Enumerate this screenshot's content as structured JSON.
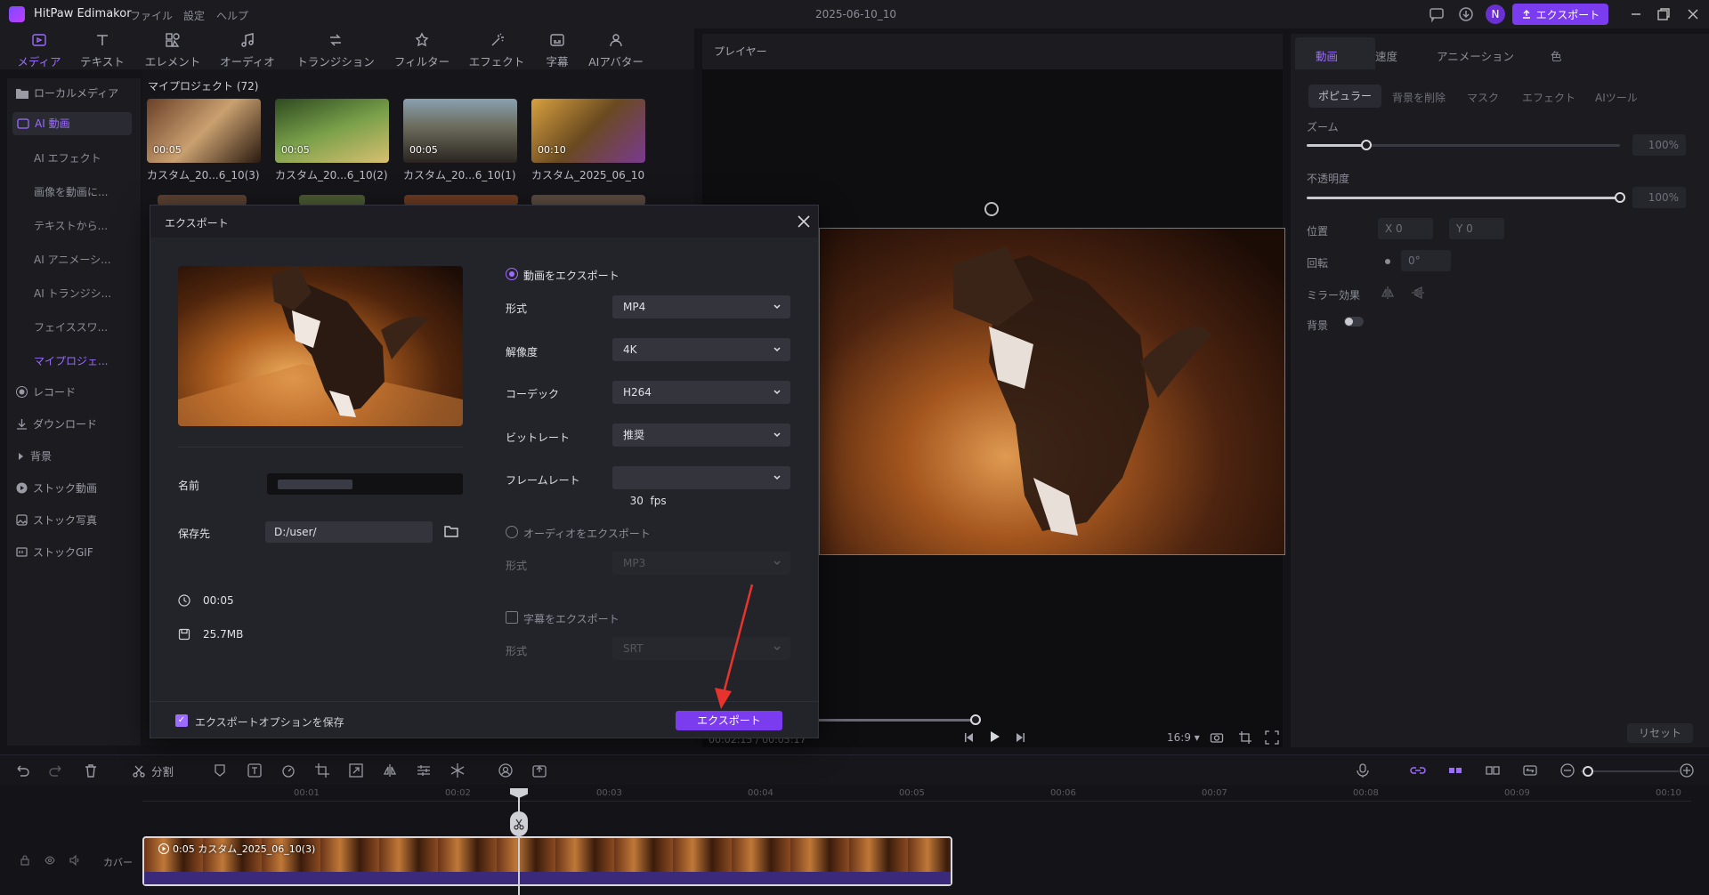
{
  "app": {
    "title": "HitPaw Edimakor",
    "menus": [
      "ファイル",
      "設定",
      "ヘルプ"
    ],
    "date": "2025-06-10_10",
    "avatar_letter": "N",
    "export_label": "エクスポート",
    "accent": "#7b3cf0"
  },
  "toolbar": {
    "tools": [
      {
        "label": "メディア",
        "icon": "media-icon"
      },
      {
        "label": "テキスト",
        "icon": "text-icon"
      },
      {
        "label": "エレメント",
        "icon": "element-icon"
      },
      {
        "label": "オーディオ",
        "icon": "audio-icon"
      },
      {
        "label": "トランジション",
        "icon": "transition-icon"
      },
      {
        "label": "フィルター",
        "icon": "filter-icon"
      },
      {
        "label": "エフェクト",
        "icon": "effect-icon"
      },
      {
        "label": "字幕",
        "icon": "subtitle-icon"
      },
      {
        "label": "AIアバター",
        "icon": "avatar-icon"
      }
    ]
  },
  "sidebar": {
    "items": [
      {
        "label": "ローカルメディア"
      },
      {
        "label": "AI 動画"
      },
      {
        "label": "AI エフェクト"
      },
      {
        "label": "画像を動画に..."
      },
      {
        "label": "テキストから..."
      },
      {
        "label": "AI アニメーシ..."
      },
      {
        "label": "AI トランジシ..."
      },
      {
        "label": "フェイススワ..."
      },
      {
        "label": "マイプロジェ..."
      },
      {
        "label": "レコード"
      },
      {
        "label": "ダウンロード"
      },
      {
        "label": "背景"
      },
      {
        "label": "ストック動画"
      },
      {
        "label": "ストック写真"
      },
      {
        "label": "ストックGIF"
      }
    ]
  },
  "media": {
    "header": "マイプロジェクト (72)",
    "thumbs": [
      {
        "duration": "00:05",
        "name": "カスタム_20...6_10(3)"
      },
      {
        "duration": "00:05",
        "name": "カスタム_20...6_10(2)"
      },
      {
        "duration": "00:05",
        "name": "カスタム_20...6_10(1)"
      },
      {
        "duration": "00:10",
        "name": "カスタム_2025_06_10"
      }
    ]
  },
  "player": {
    "title": "プレイヤー",
    "time": "00:02:15 / 00:05:17",
    "ratio": "16:9"
  },
  "right_panel": {
    "tabs": [
      "動画",
      "速度",
      "アニメーション",
      "色"
    ],
    "subtabs": [
      "ポピュラー",
      "背景を削除",
      "マスク",
      "エフェクト",
      "AIツール"
    ],
    "zoom_label": "ズーム",
    "zoom_value": "100%",
    "zoom_level": 0.19,
    "opacity_label": "不透明度",
    "opacity_value": "100%",
    "opacity_level": 1.0,
    "position_label": "位置",
    "pos_x": "X 0",
    "pos_y": "Y 0",
    "rotate_label": "回転",
    "rotate_value": "0°",
    "mirror_label": "ミラー効果",
    "bg_label": "背景",
    "reset": "リセット"
  },
  "timeline": {
    "split_label": "分割",
    "ruler": [
      "00:01",
      "00:02",
      "00:03",
      "00:04",
      "00:05",
      "00:06",
      "00:07",
      "00:08",
      "00:09",
      "00:10"
    ],
    "clip_label": "0:05 カスタム_2025_06_10(3)",
    "cover_label": "カバー"
  },
  "modal": {
    "title": "エクスポート",
    "name_label": "名前",
    "save_label": "保存先",
    "save_path": "D:/user/",
    "duration": "00:05",
    "size": "25.7MB",
    "video_export_label": "動画をエクスポート",
    "fields": [
      {
        "label": "形式",
        "value": "MP4"
      },
      {
        "label": "解像度",
        "value": "4K"
      },
      {
        "label": "コーデック",
        "value": "H264"
      },
      {
        "label": "ビットレート",
        "value": "推奨"
      },
      {
        "label": "フレームレート",
        "value": "30  fps"
      }
    ],
    "audio_export_label": "オーディオをエクスポート",
    "audio_format_label": "形式",
    "audio_format_value": "MP3",
    "subtitle_export_label": "字幕をエクスポート",
    "subtitle_format_label": "形式",
    "subtitle_format_value": "SRT",
    "save_options_label": "エクスポートオプションを保存",
    "export_button": "エクスポート"
  }
}
